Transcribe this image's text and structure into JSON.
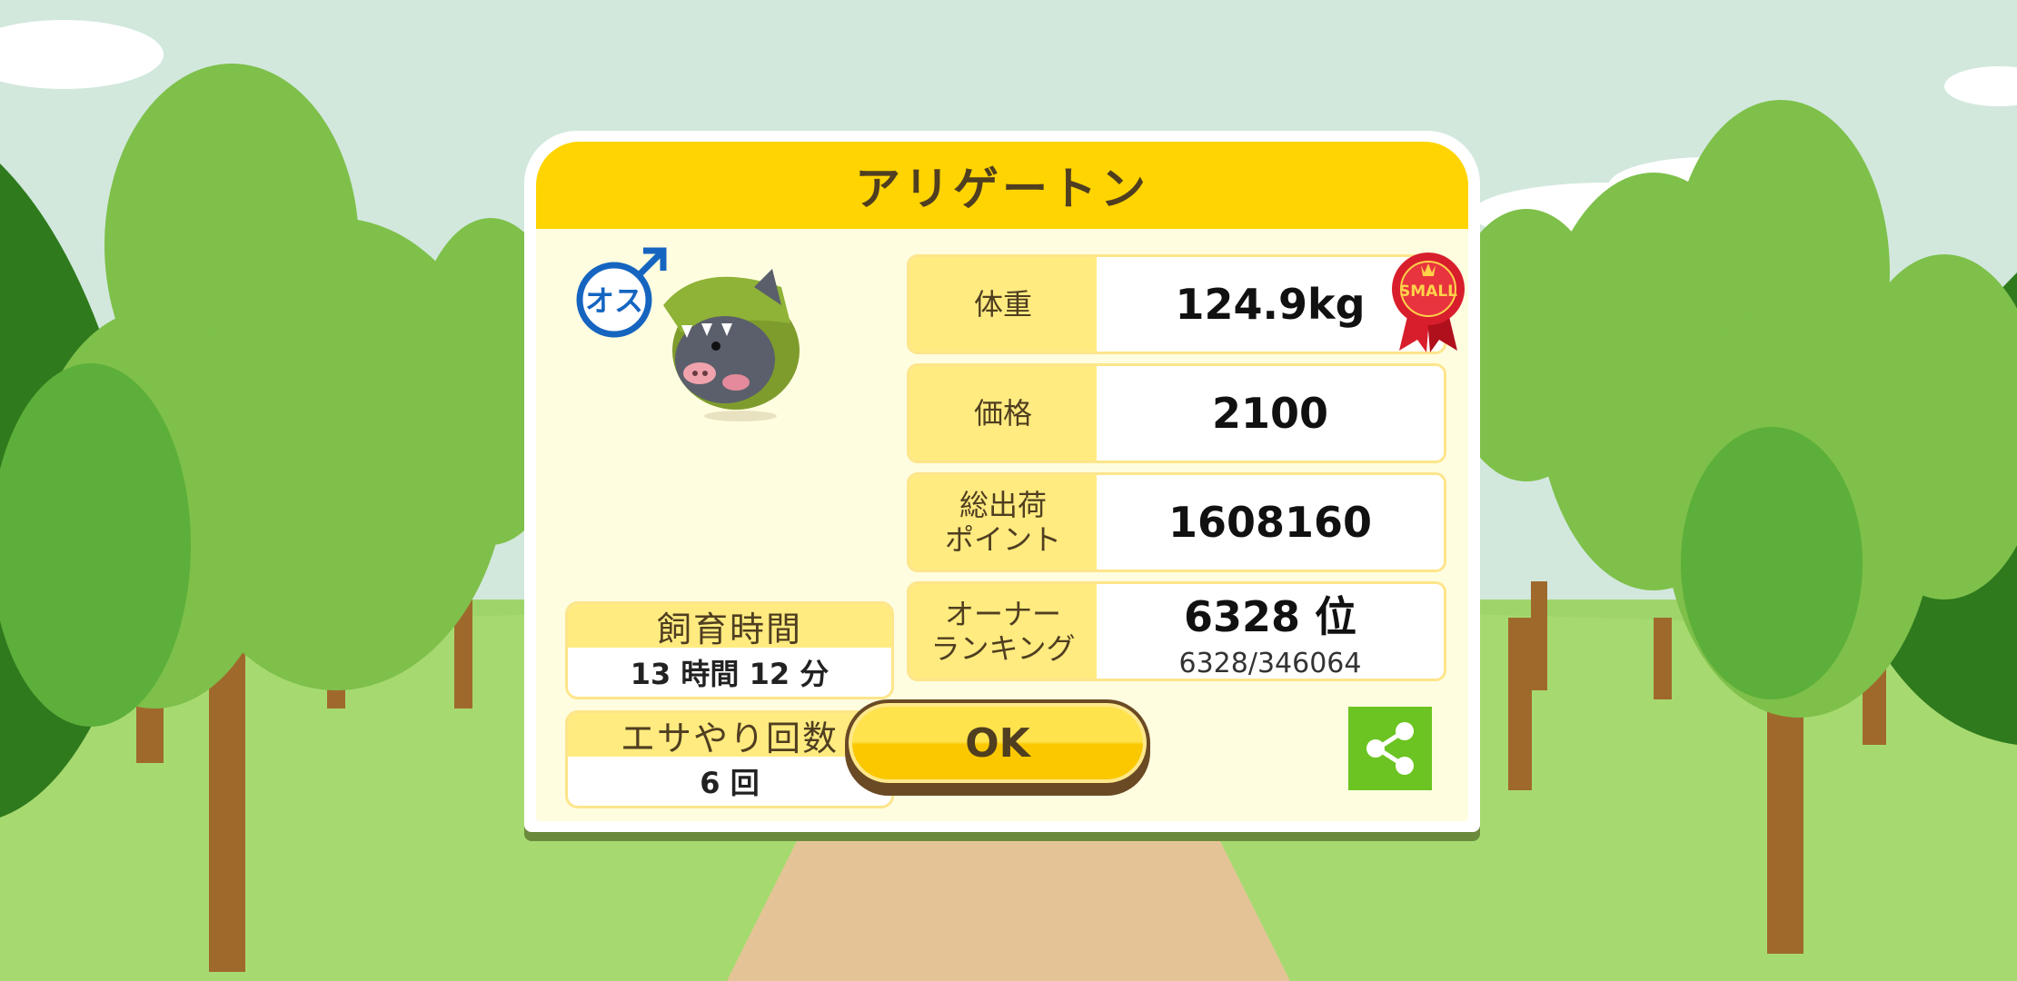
{
  "dialog": {
    "title": "アリゲートン",
    "gender_label": "オス",
    "badge_label": "SMALL"
  },
  "left": {
    "raising_time": {
      "label": "飼育時間",
      "value": "13 時間 12 分"
    },
    "feed_count": {
      "label": "エサやり回数",
      "value": "6 回"
    }
  },
  "stats": {
    "weight": {
      "label": "体重",
      "value": "124.9kg"
    },
    "price": {
      "label": "価格",
      "value": "2100"
    },
    "total_points": {
      "label": "総出荷\nポイント",
      "value": "1608160"
    },
    "owner_ranking": {
      "label": "オーナー\nランキング",
      "value": "6328 位",
      "sub": "6328/346064"
    }
  },
  "buttons": {
    "ok_label": "OK",
    "share_icon": "share-icon"
  },
  "colors": {
    "title_bar": "#ffd400",
    "label_bg": "#ffeb80",
    "panel_bg": "#fffde0",
    "share_green": "#6bc421",
    "gender_blue": "#1565c0",
    "ribbon_red": "#d81e2c"
  }
}
